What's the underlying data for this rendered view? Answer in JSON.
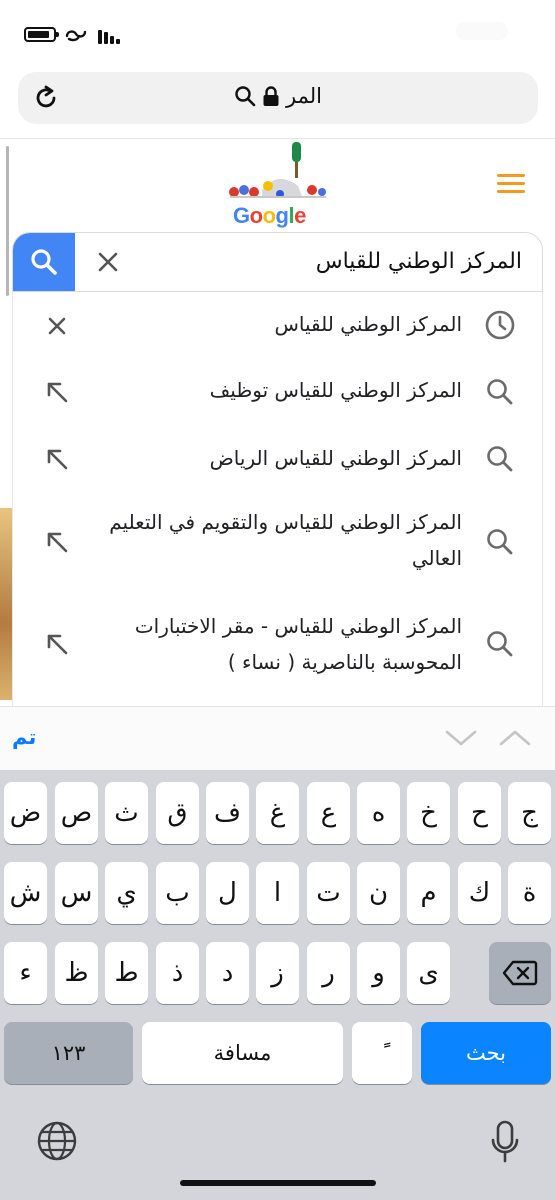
{
  "browser": {
    "url_text": "المر",
    "icons": {
      "reload": "reload-icon",
      "lock": "lock-icon",
      "search": "search-icon"
    }
  },
  "google": {
    "doodle_word": "Google",
    "menu_color": "#f39a1c"
  },
  "search": {
    "value": "المركز الوطني للقياس",
    "button_color": "#4285f4"
  },
  "suggestions": [
    {
      "text": "المركز الوطني للقياس",
      "icon": "history-clock-icon",
      "action": "remove-x-icon"
    },
    {
      "text": "المركز الوطني للقياس توظيف",
      "icon": "search-icon",
      "action": "fill-arrow-icon"
    },
    {
      "text": "المركز الوطني للقياس الرياض",
      "icon": "search-icon",
      "action": "fill-arrow-icon"
    },
    {
      "text": "المركز الوطني للقياس والتقويم في التعليم العالي",
      "icon": "search-icon",
      "action": "fill-arrow-icon"
    },
    {
      "text": "المركز الوطني للقياس - مقر الاختبارات المحوسبة بالناصرية ( نساء )",
      "icon": "search-icon",
      "action": "fill-arrow-icon"
    }
  ],
  "accessory": {
    "done_label": "تم"
  },
  "keyboard": {
    "row1": [
      "ج",
      "ح",
      "خ",
      "ه",
      "ع",
      "غ",
      "ف",
      "ق",
      "ث",
      "ص",
      "ض"
    ],
    "row2": [
      "ة",
      "ك",
      "م",
      "ن",
      "ت",
      "ا",
      "ل",
      "ب",
      "ي",
      "س",
      "ش"
    ],
    "row3": [
      "ى",
      "و",
      "ر",
      "ز",
      "د",
      "ذ",
      "ط",
      "ظ",
      "ء"
    ],
    "numbers_label": "١٢٣",
    "space_label": "مسافة",
    "diacritic_label": "ًً",
    "search_label": "بحث",
    "search_key_color": "#0a84ff"
  }
}
